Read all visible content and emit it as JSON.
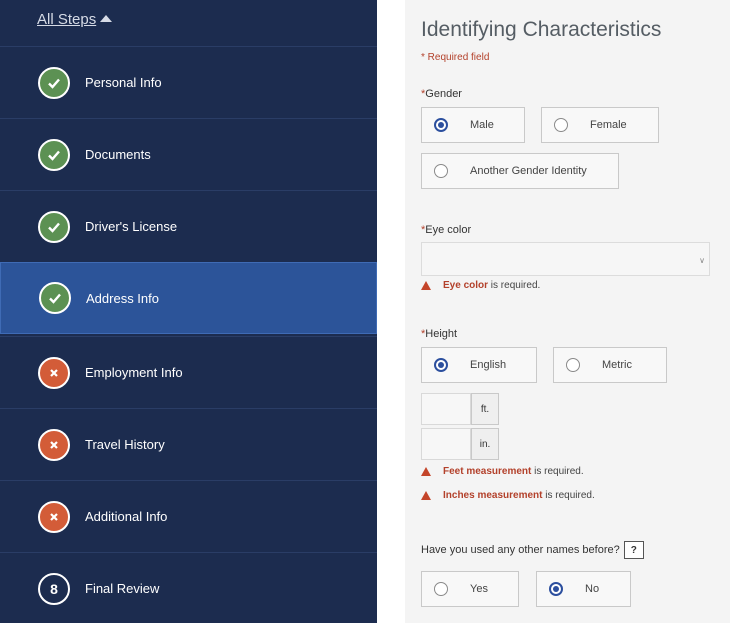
{
  "sidebar": {
    "all_steps_label": "All Steps",
    "steps": [
      {
        "label": "Personal Info",
        "status": "complete",
        "icon": "check-icon"
      },
      {
        "label": "Documents",
        "status": "complete",
        "icon": "check-icon"
      },
      {
        "label": "Driver's License",
        "status": "complete",
        "icon": "check-icon"
      },
      {
        "label": "Address Info",
        "status": "complete",
        "icon": "check-icon",
        "active": true
      },
      {
        "label": "Employment Info",
        "status": "error",
        "icon": "x-icon"
      },
      {
        "label": "Travel History",
        "status": "error",
        "icon": "x-icon"
      },
      {
        "label": "Additional Info",
        "status": "error",
        "icon": "x-icon"
      },
      {
        "label": "Final Review",
        "status": "pending",
        "number": "8"
      }
    ]
  },
  "form": {
    "title": "Identifying Characteristics",
    "required_note": "* Required field",
    "gender": {
      "label": "Gender",
      "options": [
        "Male",
        "Female",
        "Another Gender Identity"
      ],
      "selected": "Male"
    },
    "eye_color": {
      "label": "Eye color",
      "value": "",
      "error_field": "Eye color",
      "error_text": " is required."
    },
    "height": {
      "label": "Height",
      "options": [
        "English",
        "Metric"
      ],
      "selected": "English",
      "feet_unit": "ft.",
      "inches_unit": "in.",
      "errors": [
        {
          "field": "Feet measurement",
          "text": " is required."
        },
        {
          "field": "Inches measurement",
          "text": " is required."
        }
      ]
    },
    "other_names": {
      "question": "Have you used any other names before?",
      "help": "?",
      "options": [
        "Yes",
        "No"
      ],
      "selected": "No"
    }
  },
  "colors": {
    "sidebar_bg": "#1c2c4f",
    "active_step": "#2c5499",
    "complete": "#5c9153",
    "error": "#d35c38",
    "radio_selected": "#2c4f9e"
  }
}
